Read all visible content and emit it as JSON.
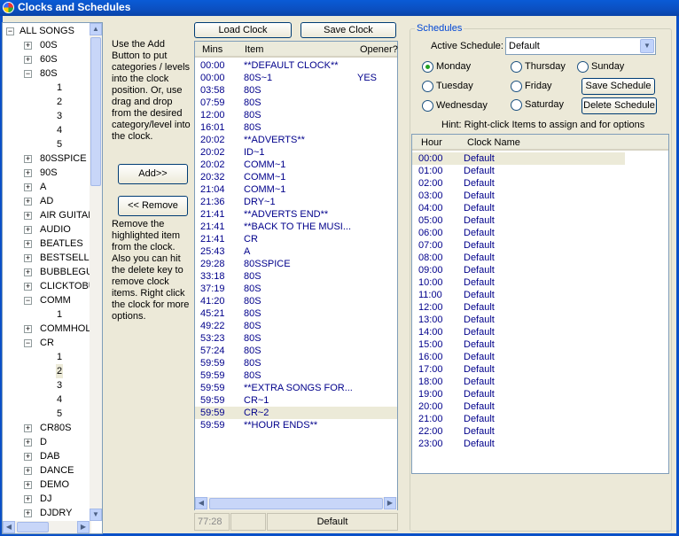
{
  "window": {
    "title": "Clocks and Schedules"
  },
  "tree": {
    "nodes": [
      {
        "label": "ALL SONGS",
        "level": 0,
        "expander": "-"
      },
      {
        "label": "00S",
        "level": 1,
        "expander": "+"
      },
      {
        "label": "60S",
        "level": 1,
        "expander": "+"
      },
      {
        "label": "80S",
        "level": 1,
        "expander": "-"
      },
      {
        "label": "1",
        "level": 2,
        "expander": ""
      },
      {
        "label": "2",
        "level": 2,
        "expander": ""
      },
      {
        "label": "3",
        "level": 2,
        "expander": ""
      },
      {
        "label": "4",
        "level": 2,
        "expander": ""
      },
      {
        "label": "5",
        "level": 2,
        "expander": ""
      },
      {
        "label": "80SSPICE",
        "level": 1,
        "expander": "+"
      },
      {
        "label": "90S",
        "level": 1,
        "expander": "+"
      },
      {
        "label": "A",
        "level": 1,
        "expander": "+"
      },
      {
        "label": "AD",
        "level": 1,
        "expander": "+"
      },
      {
        "label": "AIR GUITAR",
        "level": 1,
        "expander": "+"
      },
      {
        "label": "AUDIO",
        "level": 1,
        "expander": "+"
      },
      {
        "label": "BEATLES",
        "level": 1,
        "expander": "+"
      },
      {
        "label": "BESTSELLER",
        "level": 1,
        "expander": "+"
      },
      {
        "label": "BUBBLEGUM",
        "level": 1,
        "expander": "+"
      },
      {
        "label": "CLICKTOBU",
        "level": 1,
        "expander": "+"
      },
      {
        "label": "COMM",
        "level": 1,
        "expander": "-"
      },
      {
        "label": "1",
        "level": 2,
        "expander": ""
      },
      {
        "label": "COMMHOLD",
        "level": 1,
        "expander": "+"
      },
      {
        "label": "CR",
        "level": 1,
        "expander": "-"
      },
      {
        "label": "1",
        "level": 2,
        "expander": ""
      },
      {
        "label": "2",
        "level": 2,
        "expander": "",
        "selected": true
      },
      {
        "label": "3",
        "level": 2,
        "expander": ""
      },
      {
        "label": "4",
        "level": 2,
        "expander": ""
      },
      {
        "label": "5",
        "level": 2,
        "expander": ""
      },
      {
        "label": "CR80S",
        "level": 1,
        "expander": "+"
      },
      {
        "label": "D",
        "level": 1,
        "expander": "+"
      },
      {
        "label": "DAB",
        "level": 1,
        "expander": "+"
      },
      {
        "label": "DANCE",
        "level": 1,
        "expander": "+"
      },
      {
        "label": "DEMO",
        "level": 1,
        "expander": "+"
      },
      {
        "label": "DJ",
        "level": 1,
        "expander": "+"
      },
      {
        "label": "DJDRY",
        "level": 1,
        "expander": "+"
      }
    ]
  },
  "help": {
    "add_text": "Use the Add Button to put categories / levels into the clock position. Or, use drag and drop from the desired category/level into the clock.",
    "add_button": "Add>>",
    "remove_button": "<< Remove",
    "remove_text": "Remove the highlighted item from the clock. Also you can hit the delete key to remove clock items. Right click the clock for more options."
  },
  "clock": {
    "load_button": "Load Clock",
    "save_button": "Save Clock",
    "columns": {
      "mins": "Mins",
      "item": "Item",
      "opener": "Opener?"
    },
    "rows": [
      {
        "mins": "00:00",
        "item": "**DEFAULT CLOCK**",
        "opener": ""
      },
      {
        "mins": "00:00",
        "item": "80S~1",
        "opener": "YES"
      },
      {
        "mins": "03:58",
        "item": "80S",
        "opener": ""
      },
      {
        "mins": "07:59",
        "item": "80S",
        "opener": ""
      },
      {
        "mins": "12:00",
        "item": "80S",
        "opener": ""
      },
      {
        "mins": "16:01",
        "item": "80S",
        "opener": ""
      },
      {
        "mins": "20:02",
        "item": "**ADVERTS**",
        "opener": ""
      },
      {
        "mins": "20:02",
        "item": "ID~1",
        "opener": ""
      },
      {
        "mins": "20:02",
        "item": "COMM~1",
        "opener": ""
      },
      {
        "mins": "20:32",
        "item": "COMM~1",
        "opener": ""
      },
      {
        "mins": "21:04",
        "item": "COMM~1",
        "opener": ""
      },
      {
        "mins": "21:36",
        "item": "DRY~1",
        "opener": ""
      },
      {
        "mins": "21:41",
        "item": "**ADVERTS END**",
        "opener": ""
      },
      {
        "mins": "21:41",
        "item": "**BACK TO THE MUSI...",
        "opener": ""
      },
      {
        "mins": "21:41",
        "item": "CR",
        "opener": ""
      },
      {
        "mins": "25:43",
        "item": "A",
        "opener": ""
      },
      {
        "mins": "29:28",
        "item": "80SSPICE",
        "opener": ""
      },
      {
        "mins": "33:18",
        "item": "80S",
        "opener": ""
      },
      {
        "mins": "37:19",
        "item": "80S",
        "opener": ""
      },
      {
        "mins": "41:20",
        "item": "80S",
        "opener": ""
      },
      {
        "mins": "45:21",
        "item": "80S",
        "opener": ""
      },
      {
        "mins": "49:22",
        "item": "80S",
        "opener": ""
      },
      {
        "mins": "53:23",
        "item": "80S",
        "opener": ""
      },
      {
        "mins": "57:24",
        "item": "80S",
        "opener": ""
      },
      {
        "mins": "59:59",
        "item": "80S",
        "opener": ""
      },
      {
        "mins": "59:59",
        "item": "80S",
        "opener": ""
      },
      {
        "mins": "59:59",
        "item": "**EXTRA SONGS FOR...",
        "opener": ""
      },
      {
        "mins": "59:59",
        "item": "CR~1",
        "opener": ""
      },
      {
        "mins": "59:59",
        "item": "CR~2",
        "opener": "",
        "selected": true
      },
      {
        "mins": "59:59",
        "item": "**HOUR ENDS**",
        "opener": ""
      }
    ],
    "status_time": "77:28",
    "status_empty": "",
    "status_name": "Default"
  },
  "schedules": {
    "group_label": "Schedules",
    "active_label": "Active Schedule:",
    "active_value": "Default",
    "days": [
      {
        "label": "Monday",
        "checked": true
      },
      {
        "label": "Tuesday",
        "checked": false
      },
      {
        "label": "Wednesday",
        "checked": false
      },
      {
        "label": "Thursday",
        "checked": false
      },
      {
        "label": "Friday",
        "checked": false
      },
      {
        "label": "Saturday",
        "checked": false
      },
      {
        "label": "Sunday",
        "checked": false
      }
    ],
    "save_button": "Save Schedule",
    "delete_button": "Delete Schedule",
    "hint": "Hint: Right-click Items to assign and for options",
    "columns": {
      "hour": "Hour",
      "clock": "Clock Name"
    },
    "rows": [
      {
        "hour": "00:00",
        "clock": "Default"
      },
      {
        "hour": "01:00",
        "clock": "Default"
      },
      {
        "hour": "02:00",
        "clock": "Default"
      },
      {
        "hour": "03:00",
        "clock": "Default"
      },
      {
        "hour": "04:00",
        "clock": "Default"
      },
      {
        "hour": "05:00",
        "clock": "Default"
      },
      {
        "hour": "06:00",
        "clock": "Default"
      },
      {
        "hour": "07:00",
        "clock": "Default"
      },
      {
        "hour": "08:00",
        "clock": "Default"
      },
      {
        "hour": "09:00",
        "clock": "Default"
      },
      {
        "hour": "10:00",
        "clock": "Default"
      },
      {
        "hour": "11:00",
        "clock": "Default"
      },
      {
        "hour": "12:00",
        "clock": "Default"
      },
      {
        "hour": "13:00",
        "clock": "Default"
      },
      {
        "hour": "14:00",
        "clock": "Default"
      },
      {
        "hour": "15:00",
        "clock": "Default"
      },
      {
        "hour": "16:00",
        "clock": "Default"
      },
      {
        "hour": "17:00",
        "clock": "Default"
      },
      {
        "hour": "18:00",
        "clock": "Default"
      },
      {
        "hour": "19:00",
        "clock": "Default"
      },
      {
        "hour": "20:00",
        "clock": "Default"
      },
      {
        "hour": "21:00",
        "clock": "Default"
      },
      {
        "hour": "22:00",
        "clock": "Default"
      },
      {
        "hour": "23:00",
        "clock": "Default"
      }
    ]
  }
}
